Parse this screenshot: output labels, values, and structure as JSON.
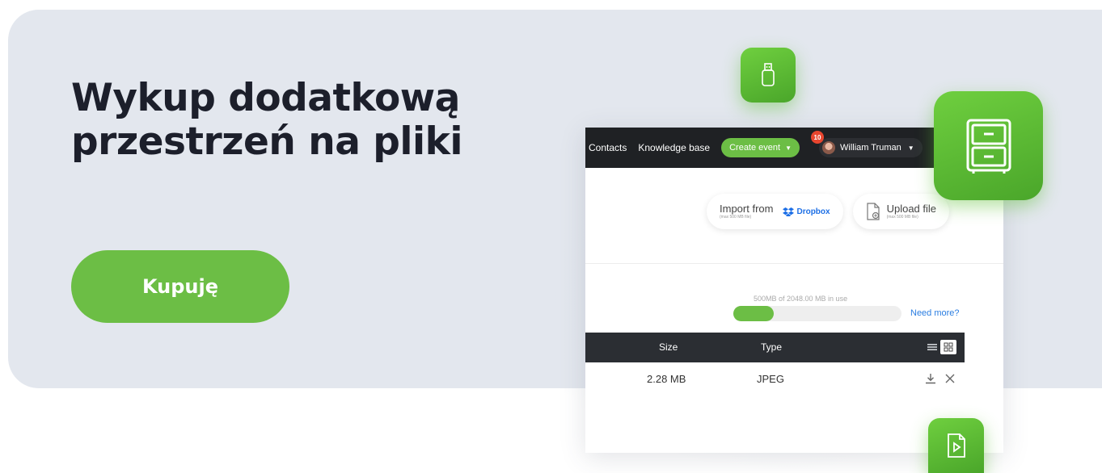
{
  "hero": {
    "headline": "Wykup dodatkową przestrzeń na pliki",
    "cta_label": "Kupuję"
  },
  "app": {
    "nav": {
      "links": [
        "Contacts",
        "Knowledge base"
      ],
      "create_event": "Create event",
      "notification_count": "10",
      "user_name": "William Truman"
    },
    "import": {
      "import_from": "Import from",
      "import_limit": "(max 500 MB file)",
      "dropbox": "Dropbox",
      "upload_file": "Upload file",
      "upload_limit": "(max 500 MB file)"
    },
    "usage": {
      "text": "500MB of 2048.00 MB in use",
      "fraction": 0.24,
      "need_more": "Need more?"
    },
    "table": {
      "headers": {
        "size": "Size",
        "type": "Type"
      },
      "rows": [
        {
          "size": "2.28 MB",
          "type": "JPEG"
        }
      ]
    }
  },
  "colors": {
    "brand_green": "#6cbe45",
    "dark_nav": "#1f2124",
    "banner_bg": "#e3e7ee",
    "link_blue": "#2a7de1"
  },
  "icons": [
    "usb-drive-icon",
    "filing-cabinet-icon",
    "video-file-icon",
    "dropbox-icon",
    "upload-file-icon",
    "list-view-icon",
    "grid-view-icon",
    "download-icon",
    "close-icon"
  ]
}
